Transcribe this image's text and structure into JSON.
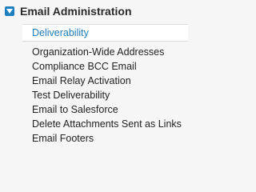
{
  "section": {
    "title": "Email Administration",
    "toggle_icon": "triangle-down-icon",
    "toggle_color": "#1f7fbf"
  },
  "selected": {
    "label": "Deliverability",
    "color": "#1e7bb8"
  },
  "items": [
    {
      "label": "Organization-Wide Addresses"
    },
    {
      "label": "Compliance BCC Email"
    },
    {
      "label": "Email Relay Activation"
    },
    {
      "label": "Test Deliverability"
    },
    {
      "label": "Email to Salesforce"
    },
    {
      "label": "Delete Attachments Sent as Links"
    },
    {
      "label": "Email Footers"
    }
  ]
}
